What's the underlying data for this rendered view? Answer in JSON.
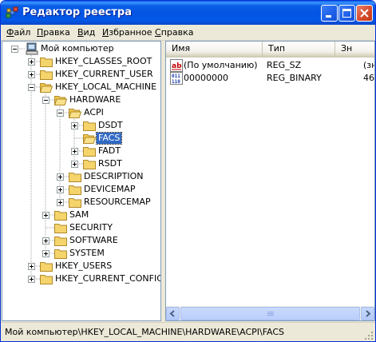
{
  "window": {
    "title": "Редактор реестра",
    "icon": "regedit-icon"
  },
  "menu": {
    "items": [
      {
        "u": "Ф",
        "rest": "айл"
      },
      {
        "u": "П",
        "rest": "равка"
      },
      {
        "u": "В",
        "rest": "ид"
      },
      {
        "u": "И",
        "rest": "збранное"
      },
      {
        "u": "С",
        "rest": "правка"
      }
    ]
  },
  "tree": {
    "root": "Мой компьютер",
    "nodes": [
      {
        "label": "HKEY_CLASSES_ROOT"
      },
      {
        "label": "HKEY_CURRENT_USER"
      },
      {
        "label": "HKEY_LOCAL_MACHINE"
      },
      {
        "label": "HARDWARE"
      },
      {
        "label": "ACPI"
      },
      {
        "label": "DSDT"
      },
      {
        "label": "FACS"
      },
      {
        "label": "FADT"
      },
      {
        "label": "RSDT"
      },
      {
        "label": "DESCRIPTION"
      },
      {
        "label": "DEVICEMAP"
      },
      {
        "label": "RESOURCEMAP"
      },
      {
        "label": "SAM"
      },
      {
        "label": "SECURITY"
      },
      {
        "label": "SOFTWARE"
      },
      {
        "label": "SYSTEM"
      },
      {
        "label": "HKEY_USERS"
      },
      {
        "label": "HKEY_CURRENT_CONFIG"
      }
    ],
    "selected": "FACS"
  },
  "list": {
    "columns": [
      "Имя",
      "Тип",
      "Зн"
    ],
    "rows": [
      {
        "name": "(По умолчанию)",
        "type": "REG_SZ",
        "value": "(зн",
        "icon": "string-value-icon"
      },
      {
        "name": "00000000",
        "type": "REG_BINARY",
        "value": "46",
        "icon": "binary-value-icon"
      }
    ]
  },
  "status": {
    "path": "Мой компьютер\\HKEY_LOCAL_MACHINE\\HARDWARE\\ACPI\\FACS"
  },
  "colors": {
    "titlebar": "#0554E3",
    "selection": "#316AC5",
    "folder": "#F5D46B"
  }
}
